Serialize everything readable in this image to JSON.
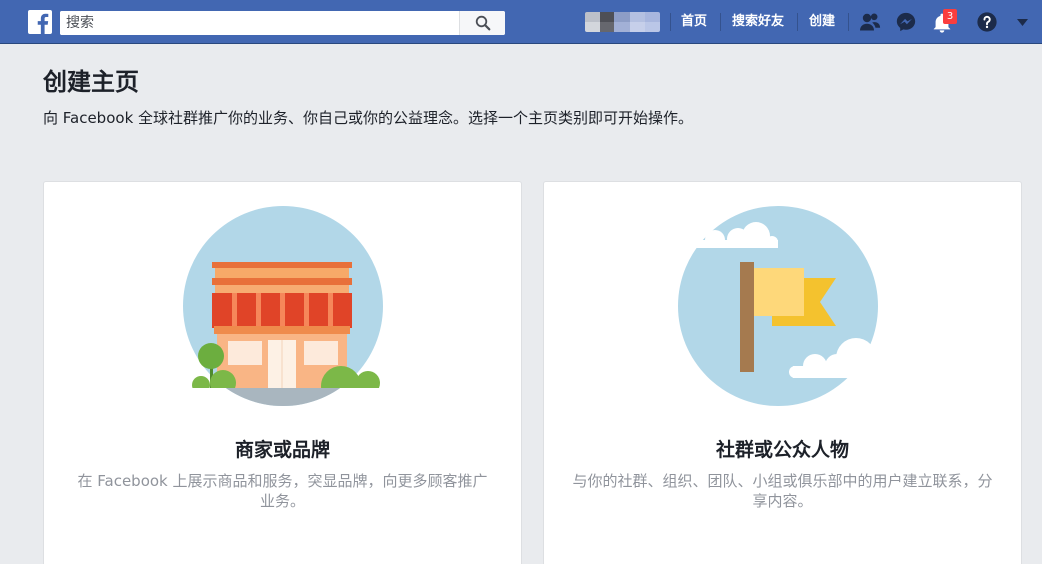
{
  "header": {
    "logo_icon": "facebook-logo-icon",
    "search": {
      "placeholder": "搜索",
      "value": "",
      "button_icon": "search-icon"
    },
    "nav": [
      {
        "label": "首页"
      },
      {
        "label": "搜索好友"
      },
      {
        "label": "创建"
      }
    ],
    "icons": {
      "friends": "friend-requests-icon",
      "messages": "messenger-icon",
      "notifications": "bell-icon",
      "help": "help-icon",
      "account_menu": "caret-down-icon"
    },
    "notifications_badge": "3"
  },
  "page": {
    "title": "创建主页",
    "subtitle": "向 Facebook 全球社群推广你的业务、你自己或你的公益理念。选择一个主页类别即可开始操作。"
  },
  "categories": [
    {
      "illustration": "storefront-illustration",
      "title": "商家或品牌",
      "description": "在 Facebook 上展示商品和服务，突显品牌，向更多顾客推广业务。"
    },
    {
      "illustration": "flag-illustration",
      "title": "社群或公众人物",
      "description": "与你的社群、组织、团队、小组或俱乐部中的用户建立联系，分享内容。"
    }
  ],
  "colors": {
    "header_bg": "#4267b2",
    "page_bg": "#e9ebee",
    "card_bg": "#ffffff",
    "badge_bg": "#fa3e3e",
    "description_text": "#90949c",
    "illustration_sky": "#b2d7e8"
  }
}
